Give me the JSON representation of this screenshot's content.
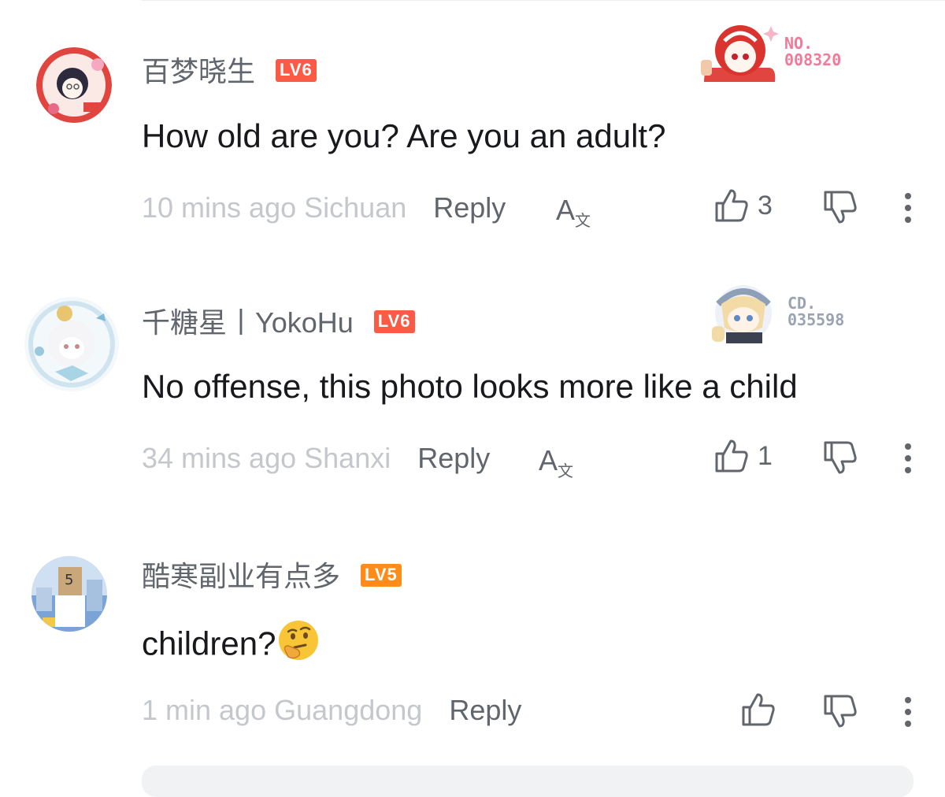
{
  "comments": [
    {
      "username": "百梦晓生",
      "level": "LV6",
      "level_color": "#fb5b45",
      "text": "How old are you? Are you an adult?",
      "time": "10 mins ago",
      "location": "Sichuan",
      "reply_label": "Reply",
      "translate_label": "A",
      "translate_sub": "文",
      "likes": "3",
      "fan_badge": {
        "line1": "NO.",
        "line2": "008320",
        "color": "#f07a9a"
      }
    },
    {
      "username": "千糖星丨YokoHu",
      "level": "LV6",
      "level_color": "#fb5b45",
      "text": "No offense, this photo looks more like a child",
      "time": "34 mins ago",
      "location": "Shanxi",
      "reply_label": "Reply",
      "translate_label": "A",
      "translate_sub": "文",
      "likes": "1",
      "fan_badge": {
        "line1": "CD.",
        "line2": "035598",
        "color": "#9aa3b0"
      }
    },
    {
      "username": "酷寒副业有点多",
      "level": "LV5",
      "level_color": "#ff8c1a",
      "text": "children?",
      "emoji": "thinking-face",
      "time": "1 min ago",
      "location": "Guangdong",
      "reply_label": "Reply",
      "likes": ""
    }
  ]
}
